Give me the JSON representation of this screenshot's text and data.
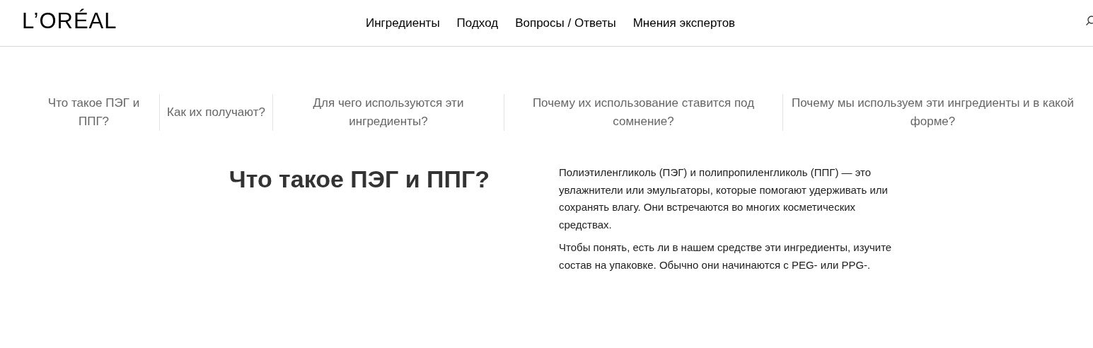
{
  "header": {
    "logo": "L’ORÉAL",
    "nav": [
      "Ингредиенты",
      "Подход",
      "Вопросы / Ответы",
      "Мнения экспертов"
    ]
  },
  "sections_nav": [
    "Что такое ПЭГ и ППГ?",
    "Как их получают?",
    "Для чего используются эти ингредиенты?",
    "Почему их использование ставится под сомнение?",
    "Почему мы используем эти ингредиенты и в какой форме?"
  ],
  "section": {
    "heading": "Что такое ПЭГ и ППГ?",
    "paragraphs": [
      "Полиэтиленгликоль (ПЭГ) и полипропиленгликоль (ППГ) — это увлажнители или эмульгаторы, которые помогают удерживать или сохранять влагу. Они встречаются во многих косметических средствах.",
      "Чтобы понять, есть ли в нашем средстве эти ингредиенты, изучите состав на упаковке. Обычно они начинаются с PEG- или PPG-."
    ]
  }
}
